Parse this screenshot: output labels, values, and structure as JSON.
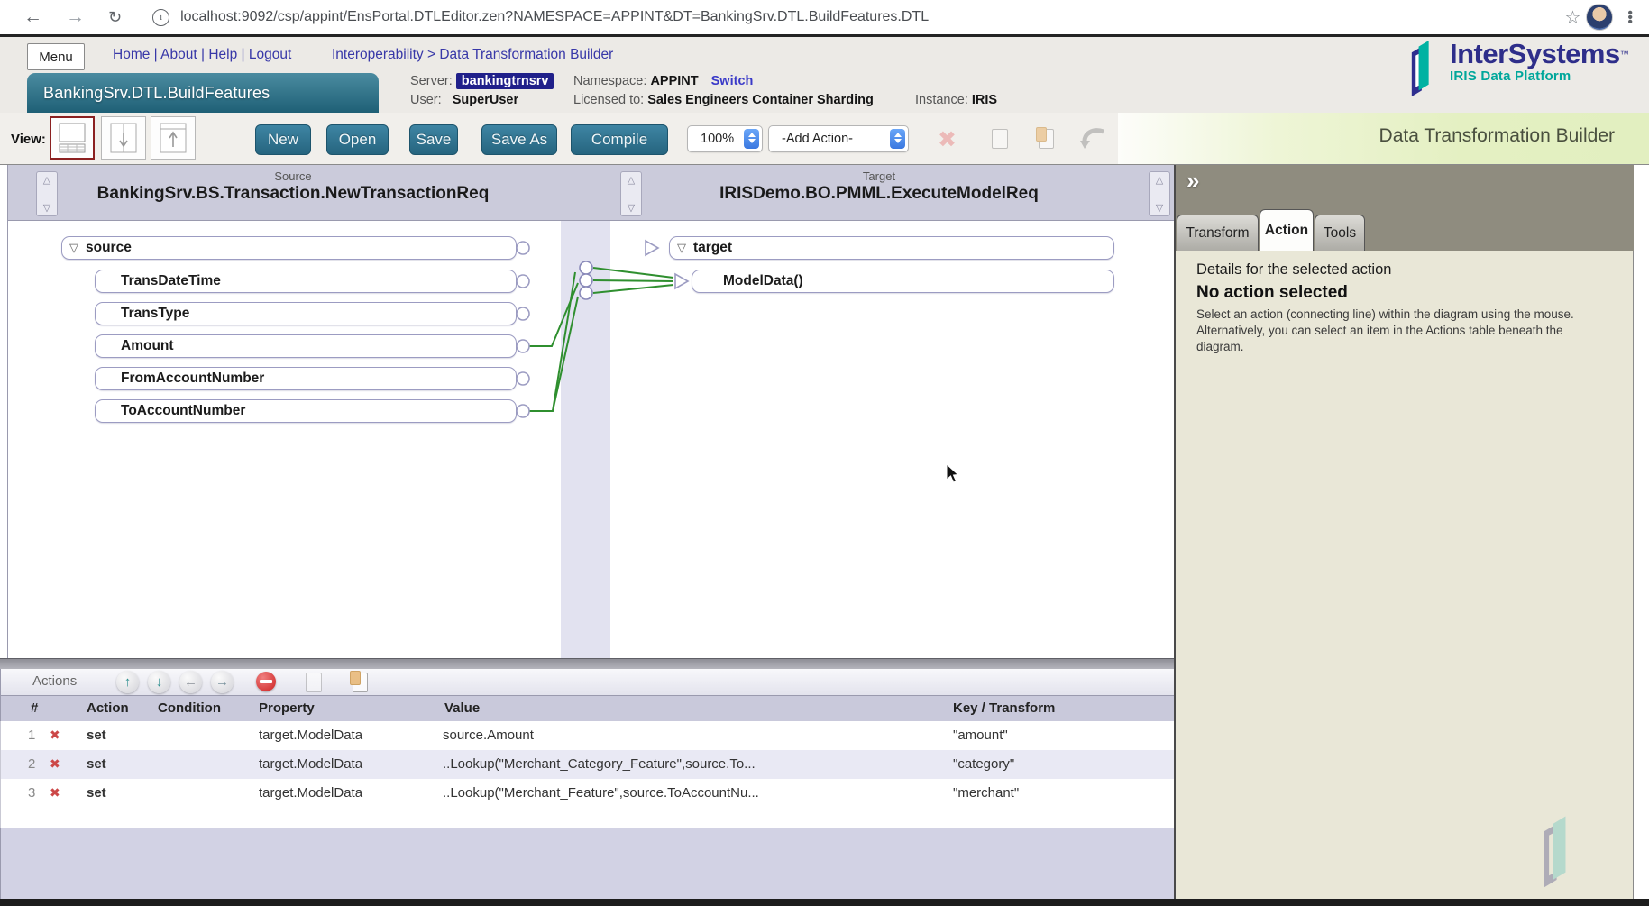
{
  "browser": {
    "url": "localhost:9092/csp/appint/EnsPortal.DTLEditor.zen?NAMESPACE=APPINT&DT=BankingSrv.DTL.BuildFeatures.DTL"
  },
  "header": {
    "menu_button": "Menu",
    "nav_links": [
      "Home",
      "About",
      "Help",
      "Logout"
    ],
    "nav_separator": "|",
    "breadcrumb": {
      "items": [
        "Interoperability",
        "Data Transformation Builder"
      ],
      "separator": ">"
    },
    "doc_tab": "BankingSrv.DTL.BuildFeatures",
    "server_label": "Server:",
    "server": "bankingtrnsrv",
    "namespace_label": "Namespace:",
    "namespace": "APPINT",
    "switch_link": "Switch",
    "user_label": "User:",
    "user": "SuperUser",
    "licensed_label": "Licensed to:",
    "licensed": "Sales Engineers Container Sharding",
    "instance_label": "Instance:",
    "instance": "IRIS",
    "logo": {
      "brand": "InterSystems",
      "tm": "™",
      "subtitle": "IRIS Data Platform"
    }
  },
  "toolbar": {
    "view_label": "View:",
    "new_label": "New",
    "open_label": "Open",
    "save_label": "Save",
    "save_as_label": "Save As",
    "compile_label": "Compile",
    "zoom_value": "100%",
    "add_action_value": "-Add Action-",
    "banner": "Data Transformation Builder"
  },
  "diagram": {
    "source_label": "Source",
    "source_class": "BankingSrv.BS.Transaction.NewTransactionReq",
    "target_label": "Target",
    "target_class": "IRISDemo.BO.PMML.ExecuteModelReq",
    "source_root": "source",
    "expander": "▽",
    "source_fields": [
      "TransDateTime",
      "TransType",
      "Amount",
      "FromAccountNumber",
      "ToAccountNumber"
    ],
    "target_root": "target",
    "target_field": "ModelData()"
  },
  "side_panel": {
    "collapse_icon": "»",
    "tabs": [
      "Transform",
      "Action",
      "Tools"
    ],
    "active_tab": "Action",
    "details_title": "Details for the selected action",
    "status": "No action selected",
    "description": "Select an action (connecting line) within the diagram using the mouse. Alternatively, you can select an item in the Actions table beneath the diagram."
  },
  "actions_panel": {
    "title": "Actions",
    "columns": {
      "num": "#",
      "action": "Action",
      "condition": "Condition",
      "property": "Property",
      "value": "Value",
      "key": "Key / Transform"
    },
    "delete_glyph": "✖",
    "rows": [
      {
        "num": "1",
        "action": "set",
        "condition": "",
        "property": "target.ModelData",
        "value": "source.Amount",
        "key": "\"amount\""
      },
      {
        "num": "2",
        "action": "set",
        "condition": "",
        "property": "target.ModelData",
        "value": "..Lookup(\"Merchant_Category_Feature\",source.To...",
        "key": "\"category\""
      },
      {
        "num": "3",
        "action": "set",
        "condition": "",
        "property": "target.ModelData",
        "value": "..Lookup(\"Merchant_Feature\",source.ToAccountNu...",
        "key": "\"merchant\""
      }
    ]
  },
  "colors": {
    "button_teal": "#2e7090",
    "banner_green": "#e4f0c2",
    "server_badge_navy": "#20208a",
    "link_indigo": "#3838a8",
    "connection_green": "#2f8f2f",
    "brand_indigo": "#2e2e8a",
    "brand_teal": "#00b2a2",
    "panel_beige": "#e9e7d7",
    "panel_gray": "#8f8c7f"
  }
}
